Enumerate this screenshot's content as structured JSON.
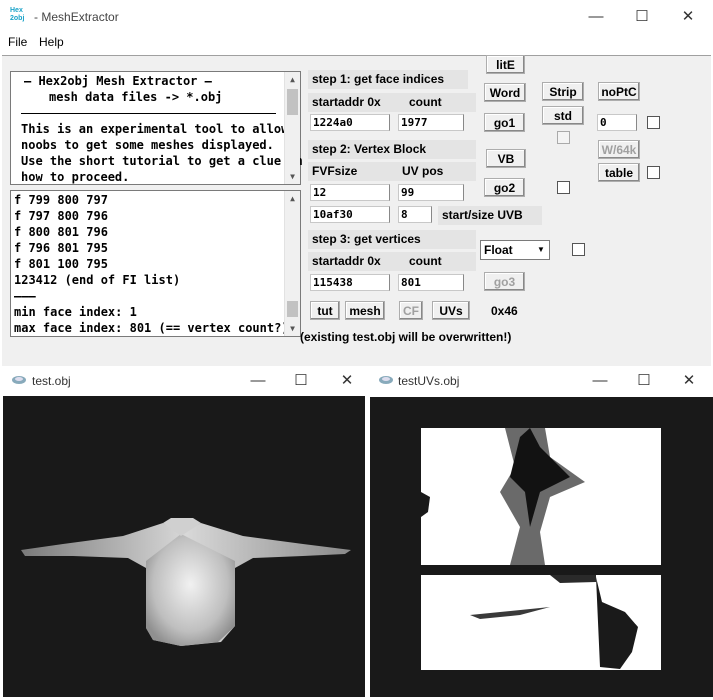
{
  "window": {
    "title": "MeshExtractor",
    "app_icon_text": "Hex\n2obj",
    "menu": [
      "File",
      "Help"
    ],
    "controls": {
      "min": "—",
      "max": "☐",
      "close": "✕"
    }
  },
  "info_text": {
    "line1": "—   Hex2obj Mesh Extractor   —",
    "line2": "mesh data files -> *.obj",
    "body": "This is an experimental tool to allow\nnoobs to get some meshes displayed.\nUse the short tutorial to get a clue on\nhow to proceed."
  },
  "log_text": {
    "lines": [
      "f  799 800 797",
      "f  797 800 796",
      "f  800 801 796",
      "f  796 801 795",
      "f  801 100 795",
      "123412 (end of FI list)",
      "———",
      "min face index: 1",
      "max face index: 801 (== vertex count?)"
    ]
  },
  "step1": {
    "title": "step 1: get face indices",
    "addr_label": "startaddr 0x",
    "count_label": "count",
    "addr_value": "1224a0",
    "count_value": "1977",
    "go_label": "go1"
  },
  "step2": {
    "title": "step 2: Vertex Block",
    "fvf_label": "FVFsize",
    "uvpos_label": "UV pos",
    "fvf_value": "12",
    "uvpos_value": "99",
    "uvb_start": "10af30",
    "uvb_size": "8",
    "uvb_label": "start/size UVB",
    "vb_label": "VB",
    "go_label": "go2"
  },
  "step3": {
    "title": "step 3: get vertices",
    "addr_label": "startaddr 0x",
    "count_label": "count",
    "addr_value": "115438",
    "count_value": "801",
    "go_label": "go3",
    "format_value": "Float"
  },
  "buttons": {
    "lite": "litE",
    "word": "Word",
    "strip": "Strip",
    "noptc": "noPtC",
    "std": "std",
    "w64": "W/64k",
    "table": "table",
    "tut": "tut",
    "mesh": "mesh",
    "cf": "CF",
    "uvs": "UVs"
  },
  "field_zero": "0",
  "hex_readout": "0x46",
  "warning": "(existing test.obj will be overwritten!)",
  "test_window": {
    "title": "test.obj"
  },
  "uv_window": {
    "title": "testUVs.obj"
  }
}
